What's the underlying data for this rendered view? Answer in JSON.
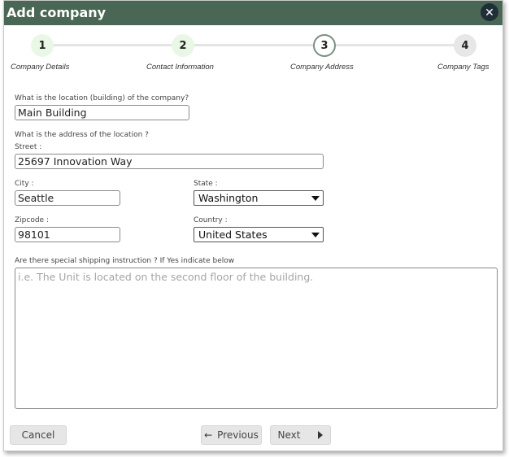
{
  "dialog": {
    "title": "Add company",
    "close_icon": "close-icon"
  },
  "stepper": {
    "steps": [
      {
        "number": "1",
        "label": "Company Details",
        "state": "done"
      },
      {
        "number": "2",
        "label": "Contact Information",
        "state": "done"
      },
      {
        "number": "3",
        "label": "Company Address",
        "state": "active"
      },
      {
        "number": "4",
        "label": "Company Tags",
        "state": "pending"
      }
    ],
    "colors": {
      "done": "#e9f8e6",
      "active_border": "#7a8f80",
      "pending": "#e7e7e7"
    }
  },
  "form": {
    "location_question": "What is the location (building) of the company?",
    "location_value": "Main Building",
    "address_question": "What is the address of the location ?",
    "street_label": "Street :",
    "street_value": "25697 Innovation Way",
    "city_label": "City :",
    "city_value": "Seattle",
    "state_label": "State :",
    "state_value": "Washington",
    "zipcode_label": "Zipcode :",
    "zipcode_value": "98101",
    "country_label": "Country :",
    "country_value": "United States",
    "shipping_question": "Are there special shipping instruction ? If Yes indicate below",
    "shipping_placeholder": "i.e. The Unit is located on the second floor of the building."
  },
  "footer": {
    "cancel_label": "Cancel",
    "previous_label": "Previous",
    "next_label": "Next"
  },
  "theme": {
    "header_color": "#4a6654",
    "close_color": "#1f2f38"
  }
}
